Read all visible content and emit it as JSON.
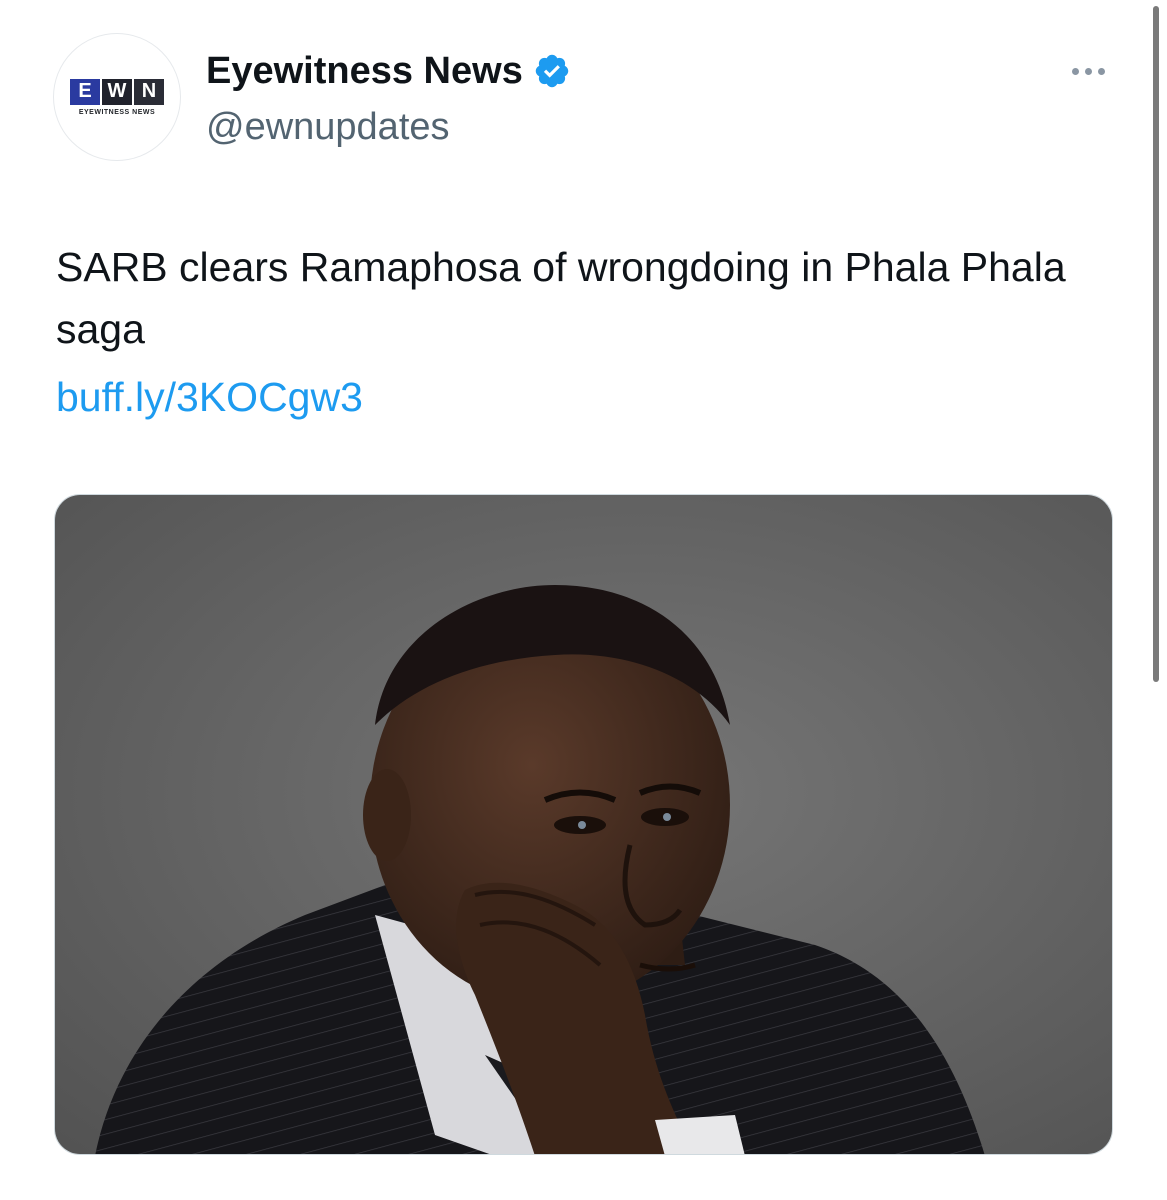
{
  "tweet": {
    "display_name": "Eyewitness News",
    "handle": "@ewnupdates",
    "verified_color": "#1d9bf0",
    "avatar": {
      "letters": [
        "E",
        "W",
        "N"
      ],
      "subtitle": "EYEWITNESS NEWS",
      "icon": "ewn-logo"
    },
    "more_icon": "more-horizontal-icon",
    "text": "SARB clears Ramaphosa of wrongdoing in Phala Phala saga",
    "link": "buff.ly/3KOCgw3",
    "link_color": "#1d9bf0",
    "media": {
      "icon": "photo-man-in-suit"
    }
  }
}
